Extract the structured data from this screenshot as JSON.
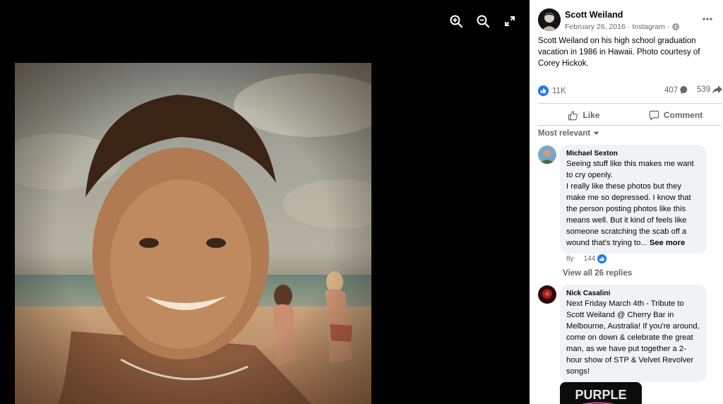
{
  "post": {
    "author": "Scott Weiland",
    "date": "February 26, 2016",
    "source": "Instagram",
    "separator": "·",
    "caption": "Scott Weiland on his high school graduation vacation in 1986 in Hawaii. Photo courtesy of Corey Hickok."
  },
  "stats": {
    "likes": "11K",
    "comments": "407",
    "shares": "539"
  },
  "actions": {
    "like_label": "Like",
    "comment_label": "Comment"
  },
  "sort": {
    "label": "Most relevant"
  },
  "comments": [
    {
      "name": "Michael Sexton",
      "text": "Seeing stuff like this makes me want to cry openly.\nI really like these photos but they make me so depressed. I know that the person posting photos like this means well. But it kind of feels like someone scratching the scab off a wound that's trying to...",
      "see_more": "See more",
      "age": "8y",
      "reactions": "144",
      "replies_label": "View all 26 replies"
    },
    {
      "name": "Nick Casalini",
      "text": "Next Friday March 4th - Tribute to Scott Weiland @ Cherry Bar in Melbourne, Australia! If you're around, come on down & celebrate the great man, as we have put together a 2-hour show of STP & Velvet Revolver songs!",
      "attachment_text": "PURPLE"
    }
  ],
  "icons": {
    "zoom_in": "zoom-in-icon",
    "zoom_out": "zoom-out-icon",
    "fullscreen": "fullscreen-icon",
    "more": "more-options-icon",
    "globe": "globe-icon",
    "like_reaction": "like-reaction-icon",
    "comment": "comment-bubble-icon",
    "share": "share-arrow-icon",
    "thumbs_up": "thumbs-up-icon",
    "chevron": "chevron-down-icon"
  },
  "colors": {
    "facebook_blue": "#1877f2",
    "secondary_text": "#65676b",
    "bubble_bg": "#f0f2f5",
    "viewer_bg": "#000000"
  }
}
